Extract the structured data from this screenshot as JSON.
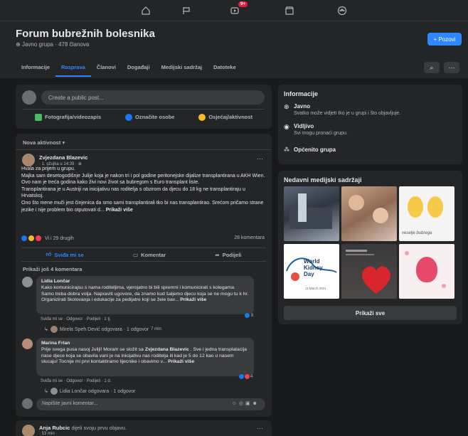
{
  "topnav": {
    "notif_badge": "9+"
  },
  "header": {
    "title": "Forum bubrežnih bolesnika",
    "subtitle": "Javno grupa · 478 članova",
    "invite_label": "+ Pozovi",
    "search_icon": "⌕",
    "more_icon": "···",
    "tabs": [
      "Informacije",
      "Rasprava",
      "Članovi",
      "Događaji",
      "Medijski sadržaj",
      "Datoteke"
    ]
  },
  "composer": {
    "placeholder": "Create a public post...",
    "photo": "Fotografija/videozapis",
    "tag": "Označite osobe",
    "feeling": "Osjećaj/aktivnost"
  },
  "sort_label": "Nova aktivnost",
  "post": {
    "author": "Zvjezdana Blazevic",
    "time": "· 1. ožujka u 14:39 ·",
    "lines": [
      "Hvala za prijem u grupu.",
      "Majka sam desetogodišnje Julije koja je nakon tri i pol godine peritonejske dijalize transplantirana u AKH Wien.",
      "Ovo nam je treća godina kako živi novi život sa bubregom s  Euro transplant liste.",
      "Transplantirana je u Austriji na inicijativu nas roditelja s obzirom da djecu do 18 kg ne transplantiraju u Hrvatskoj.",
      "Ono što mene muči jest činjenica da smo sami transplantirali tko bi nas transplantirao. Srećom pričamo strane jezike i nije problem bio otputovati d..."
    ],
    "see_more": "Prikaži više",
    "reactions": "Vi i 29 drugih",
    "comments_count": "28 komentara",
    "like": "Sviđa mi se",
    "comment": "Komentar",
    "share": "Podijeli",
    "more_comments": "Prikaži još 4 komentara"
  },
  "comments": [
    {
      "author": "Lidia Lončar",
      "text": "Kako komunicirajsu s nama roditeljima, vjerojatno bi bili spremni i komunicirati s kolegama. Samo treba dobra volja. Napraviti ugovore, da znamo kud šaljemo djecu koja se ne mogu tu k hr. Organizirati školovanja i edukacije za pedijatre koji se žele bav...",
      "see_more": "Prikaži više",
      "meta": "Sviđa mi se · Odgovor · Podijeli · 1 tj.",
      "react_count": "8",
      "reply": "Mirela Speh Dević odgovara · 1 odgovor",
      "reply_time": "7 min"
    },
    {
      "author": "Marina Frlan",
      "text_pre": "Prije svega pusa nasoj Juliji! Moram se složit sa ",
      "text_mention": "Zvjezdana Blazevic",
      "text_post": " . Sve i jedna transplatacija nase djece koja se obavila vani je na inicijativu nas roditelja ili kad je 5 do 12 kao u nasem slucaju! Tocnije mi prvi kontaktiramo lijecnike i obavimo v...",
      "see_more": "Prikaži više",
      "meta": "Sviđa mi se · Odgovor · Podijeli · 1 d.",
      "react_count": "4",
      "reply": "Lidia Lončar odgovara · 1 odgovor"
    }
  ],
  "write_comment_placeholder": "Napišite javni komentar...",
  "next_post": {
    "author": "Anja Rubcic",
    "action": "dijeli svoju prvu objavu.",
    "time": "· 53 min ·"
  },
  "sidebar": {
    "info_title": "Informacije",
    "public_title": "Javno",
    "public_desc": "Svatko može vidjeti tko je u grupi i što objavljuje.",
    "visible_title": "Vidljivo",
    "visible_desc": "Svi mogu pronaći grupu.",
    "general": "Općenito grupa",
    "media_title": "Nedavni medijski sadržaji",
    "show_all": "Prikaži sve",
    "media_captions": {
      "kidney_day_1": "World",
      "kidney_day_2": "Kidney",
      "kidney_day_3": "Day",
      "kidney_date": "11 March 2021",
      "cartoon": "veselje bubrega"
    }
  },
  "colors": {
    "accent": "#2d88ff",
    "bg": "#18191a",
    "card": "#242526"
  }
}
